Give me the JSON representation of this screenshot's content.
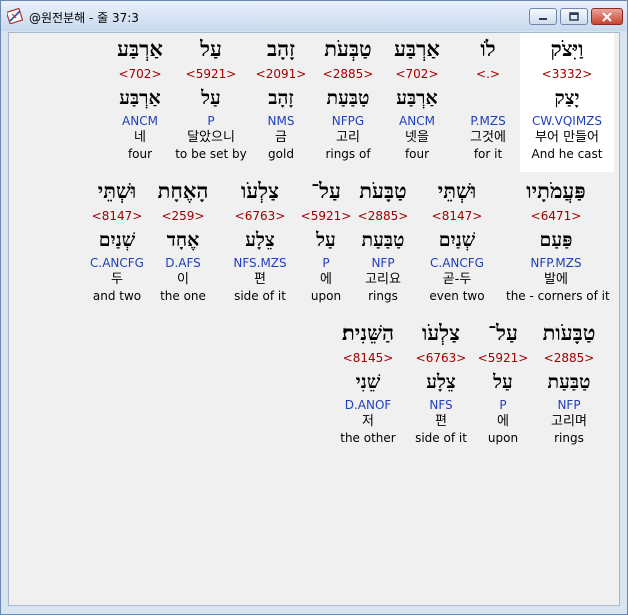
{
  "window": {
    "title": "@원전분해 - 줄 37:3",
    "icons": {
      "app": "book-pen-icon",
      "minimize": "minimize-icon",
      "maximize": "maximize-icon",
      "close": "close-icon"
    },
    "colors": {
      "strong": "#a00000",
      "code": "#1f3fbf",
      "highlight": "#ffffff",
      "background": "#f0f0f0"
    }
  },
  "lines": [
    {
      "words": [
        {
          "heb": "וַיִּצֹק",
          "strong": "<3332>",
          "lemma": "יָצַק",
          "code": "CW.VQIMZS",
          "kor": "부어 만들어",
          "eng": "And he cast",
          "highlighted": true
        },
        {
          "heb": "לֹו",
          "strong": "<.>",
          "lemma": "",
          "code": "P.MZS",
          "kor": "그것에",
          "eng": "for it"
        },
        {
          "heb": "אַרְבַּע",
          "strong": "<702>",
          "lemma": "אַרְבַּע",
          "code": "ANCM",
          "kor": "넷을",
          "eng": "four"
        },
        {
          "heb": "טַבְּעֹת",
          "strong": "<2885>",
          "lemma": "טַבַּעַת",
          "code": "NFPG",
          "kor": "고리",
          "eng": "rings of"
        },
        {
          "heb": "זָהָב",
          "strong": "<2091>",
          "lemma": "זָהָב",
          "code": "NMS",
          "kor": "금",
          "eng": "gold"
        },
        {
          "heb": "עַל",
          "strong": "<5921>",
          "lemma": "עַל",
          "code": "P",
          "kor": "달았으니",
          "eng": "to be set by"
        },
        {
          "heb": "אַרְבַּע",
          "strong": "<702>",
          "lemma": "אַרְבַּע",
          "code": "ANCM",
          "kor": "네",
          "eng": "four"
        }
      ]
    },
    {
      "words": [
        {
          "heb": "פַּעֲמֹתָיו",
          "strong": "<6471>",
          "lemma": "פַּעַם",
          "code": "NFP.MZS",
          "kor": "발에",
          "eng": "the - corners of it"
        },
        {
          "heb": "וּשְׁתֵּי",
          "strong": "<8147>",
          "lemma": "שְׁנַיִם",
          "code": "C.ANCFG",
          "kor": "곧-두",
          "eng": "even two"
        },
        {
          "heb": "טַבָּעֹת",
          "strong": "<2885>",
          "lemma": "טַבַּעַת",
          "code": "NFP",
          "kor": "고리요",
          "eng": "rings"
        },
        {
          "heb": "עַל־",
          "strong": "<5921>",
          "lemma": "עַל",
          "code": "P",
          "kor": "에",
          "eng": "upon"
        },
        {
          "heb": "צַלְעֹו",
          "strong": "<6763>",
          "lemma": "צֵלָע",
          "code": "NFS.MZS",
          "kor": "편",
          "eng": "side of it"
        },
        {
          "heb": "הָאֶחָת",
          "strong": "<259>",
          "lemma": "אֶחָד",
          "code": "D.AFS",
          "kor": "이",
          "eng": "the one"
        },
        {
          "heb": "וּשְׁתֵּי",
          "strong": "<8147>",
          "lemma": "שְׁנַיִם",
          "code": "C.ANCFG",
          "kor": "두",
          "eng": "and two"
        }
      ]
    },
    {
      "words": [
        {
          "heb": "טַבָּעֹות",
          "strong": "<2885>",
          "lemma": "טַבַּעַת",
          "code": "NFP",
          "kor": "고리며",
          "eng": "rings"
        },
        {
          "heb": "עַל־",
          "strong": "<5921>",
          "lemma": "עַל",
          "code": "P",
          "kor": "에",
          "eng": "upon"
        },
        {
          "heb": "צַלְעֹו",
          "strong": "<6763>",
          "lemma": "צֵלָע",
          "code": "NFS",
          "kor": "편",
          "eng": "side of it"
        },
        {
          "heb": "הַשֵּׁנִית׃",
          "strong": "<8145>",
          "lemma": "שֵׁנִי",
          "code": "D.ANOF",
          "kor": "저",
          "eng": "the other"
        }
      ]
    }
  ]
}
